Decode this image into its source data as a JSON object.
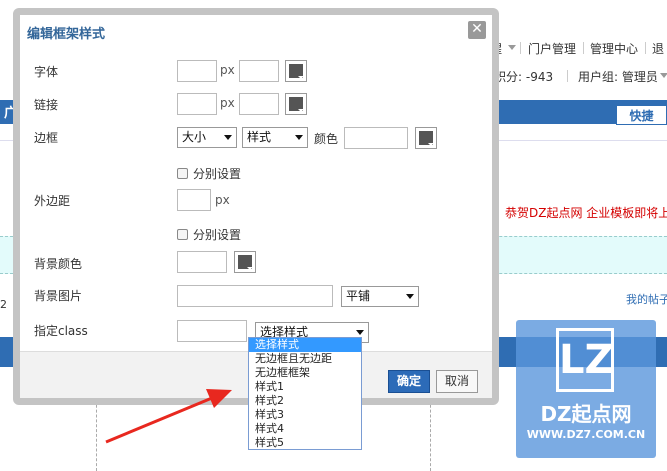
{
  "background": {
    "top_links": [
      "醒",
      "门户管理",
      "管理中心",
      "退"
    ],
    "points": "积分: -943",
    "user_group": "用户组: 管理员",
    "tab_partial": "广播",
    "quick_button": "快捷",
    "announcement": "恭贺DZ起点网 企业模板即将上线",
    "my_posts": "我的帖子",
    "small_num": "2"
  },
  "watermark": {
    "logo": "LZ",
    "title": "DZ起点网",
    "url": "WWW.DZ7.COM.CN"
  },
  "modal": {
    "title": "编辑框架样式",
    "close": "✕",
    "font_label": "字体",
    "link_label": "链接",
    "border_label": "边框",
    "margin_label": "外边距",
    "bgcolor_label": "背景颜色",
    "bgimage_label": "背景图片",
    "class_label": "指定class",
    "unit_px": "px",
    "border_size": "大小",
    "border_style": "样式",
    "color_label": "颜色",
    "separate_label": "分别设置",
    "repeat_select": "平铺",
    "class_select": "选择样式",
    "ok": "确定",
    "cancel": "取消"
  },
  "class_options": [
    "选择样式",
    "无边框且无边距",
    "无边框框架",
    "样式1",
    "样式2",
    "样式3",
    "样式4",
    "样式5"
  ],
  "colors": {
    "accent": "#2c6bb8",
    "highlight": "#3399ff",
    "title": "#336699",
    "arrow": "#e8281f"
  },
  "icons": [
    "close-icon",
    "color-picker-icon",
    "chevron-down-icon",
    "checkbox-icon",
    "red-arrow-icon"
  ]
}
